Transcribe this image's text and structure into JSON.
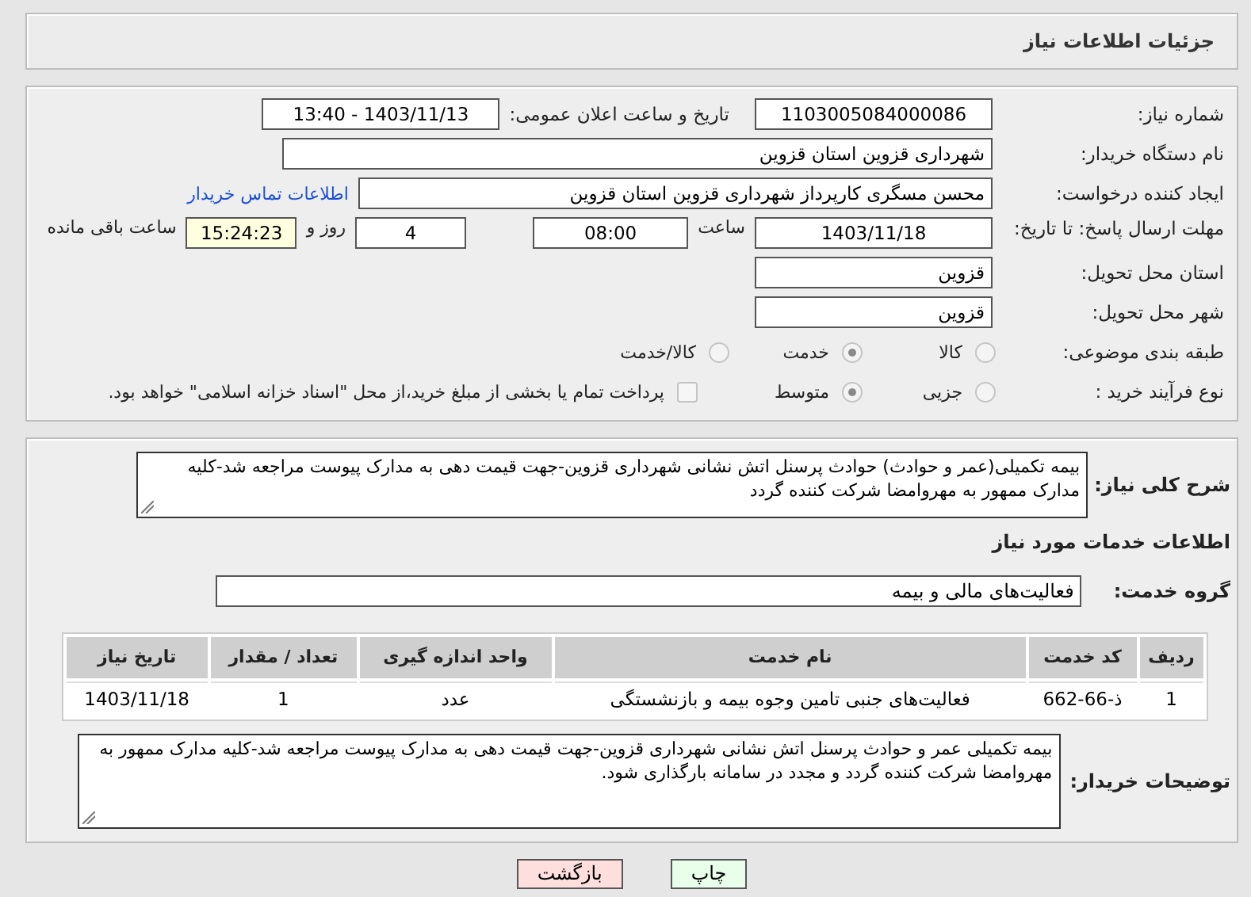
{
  "page_title": "جزئیات اطلاعات نیاز",
  "need_number": {
    "label": "شماره نیاز:",
    "value": "1103005084000086"
  },
  "announce": {
    "label": "تاریخ و ساعت اعلان عمومی:",
    "value": "1403/11/13 - 13:40"
  },
  "buyer_org": {
    "label": "نام دستگاه خریدار:",
    "value": "شهرداری قزوین استان قزوین"
  },
  "requester": {
    "label": "ایجاد کننده درخواست:",
    "value": "محسن مسگری کارپرداز شهرداری قزوین استان قزوین",
    "link": "اطلاعات تماس خریدار"
  },
  "deadline": {
    "label": "مهلت ارسال پاسخ: تا تاریخ:",
    "date": "1403/11/18",
    "time_label": "ساعت",
    "time": "08:00",
    "days": "4",
    "days_label": "روز و",
    "remaining": "15:24:23",
    "remaining_label": "ساعت باقی مانده"
  },
  "province": {
    "label": "استان محل تحویل:",
    "value": "قزوین"
  },
  "city": {
    "label": "شهر محل تحویل:",
    "value": "قزوین"
  },
  "category": {
    "label": "طبقه بندی موضوعی:",
    "options": [
      {
        "label": "کالا",
        "selected": false
      },
      {
        "label": "خدمت",
        "selected": true
      },
      {
        "label": "کالا/خدمت",
        "selected": false
      }
    ]
  },
  "process": {
    "label": "نوع فرآیند خرید :",
    "options": [
      {
        "label": "جزیی",
        "selected": false
      },
      {
        "label": "متوسط",
        "selected": true
      }
    ],
    "payment": {
      "checked": false,
      "text": "پرداخت تمام یا بخشی از مبلغ خرید،از محل \"اسناد خزانه اسلامی\" خواهد بود."
    }
  },
  "description": {
    "label": "شرح کلی نیاز:",
    "value": "بیمه تکمیلی(عمر و حوادث) حوادث پرسنل اتش نشانی شهرداری قزوین-جهت قیمت دهی به مدارک پیوست مراجعه شد-کلیه مدارک ممهور به مهروامضا شرکت کننده گردد"
  },
  "services_title": "اطلاعات خدمات مورد نیاز",
  "service_group": {
    "label": "گروه خدمت:",
    "value": "فعالیت‌های مالی و بیمه"
  },
  "table": {
    "columns": [
      "ردیف",
      "کد خدمت",
      "نام خدمت",
      "واحد اندازه گیری",
      "تعداد / مقدار",
      "تاریخ نیاز"
    ],
    "rows": [
      [
        "1",
        "ذ-66-662",
        "فعالیت‌های جنبی تامین وجوه بیمه و بازنشستگی",
        "عدد",
        "1",
        "1403/11/18"
      ]
    ]
  },
  "buyer_notes": {
    "label": "توضیحات خریدار:",
    "value": "بیمه تکمیلی عمر و حوادث پرسنل اتش نشانی شهرداری قزوین-جهت قیمت دهی به مدارک پیوست مراجعه شد-کلیه مدارک ممهور به مهروامضا شرکت کننده گردد و مجدد در سامانه بارگذاری شود."
  },
  "buttons": [
    {
      "label": "چاپ",
      "kind": "print"
    },
    {
      "label": "بازگشت",
      "kind": "back"
    }
  ]
}
